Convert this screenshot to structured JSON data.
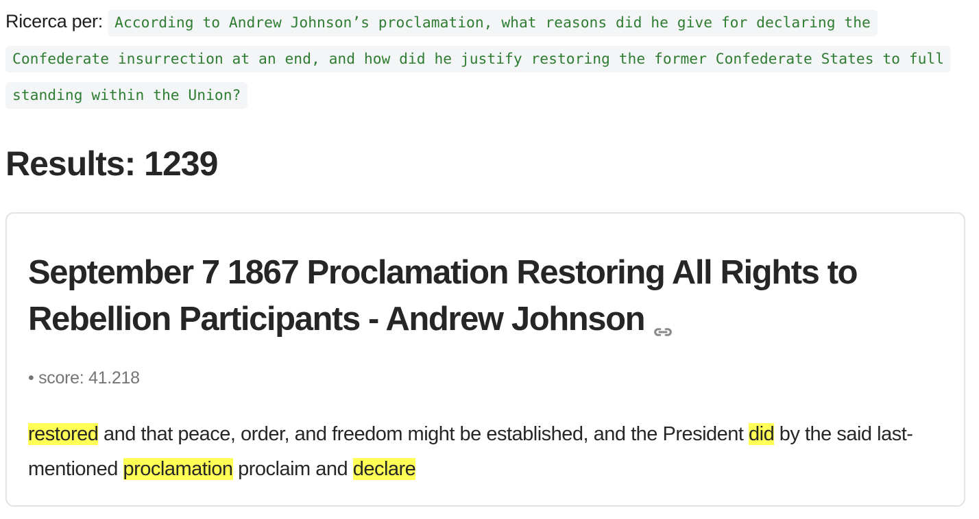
{
  "search": {
    "prefix": "Ricerca per:",
    "query": "According to Andrew Johnson’s proclamation, what reasons did he give for declaring the Confederate insurrection at an end, and how did he justify restoring the former Confederate States to full standing within the Union?"
  },
  "results": {
    "heading": "Results: 1239",
    "items": [
      {
        "title": "September 7 1867 Proclamation Restoring All Rights to Rebellion Participants - Andrew Johnson",
        "link_icon": "link-icon",
        "score_label": "• score: 41.218",
        "snippet": {
          "hl1": "restored",
          "t1": " and that peace, order, and freedom might be established, and the President ",
          "hl2": "did",
          "t2": " by the said last-mentioned ",
          "hl3": "proclamation",
          "t3": " proclaim and ",
          "hl4": "declare"
        }
      }
    ]
  },
  "colors": {
    "query_text": "#2e7d32",
    "query_background": "#f4f5f7",
    "highlight": "#ffff55",
    "card_border": "#e2e2e2"
  }
}
